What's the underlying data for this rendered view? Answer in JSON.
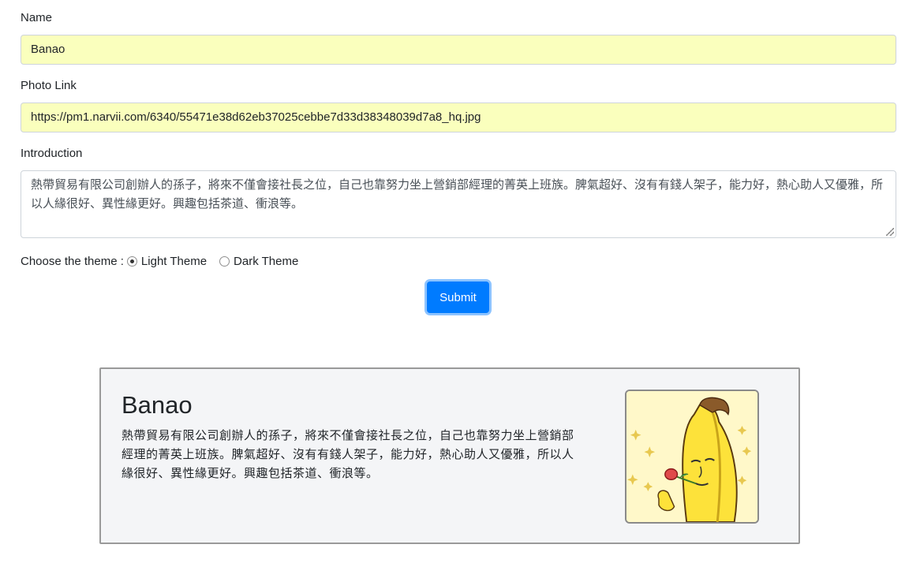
{
  "form": {
    "name_label": "Name",
    "name_value": "Banao",
    "photo_label": "Photo Link",
    "photo_value": "https://pm1.narvii.com/6340/55471e38d62eb37025cebbe7d33d38348039d7a8_hq.jpg",
    "intro_label": "Introduction",
    "intro_value": "熱帶貿易有限公司創辦人的孫子，將來不僅會接社長之位，自己也靠努力坐上營銷部經理的菁英上班族。脾氣超好、沒有有錢人架子，能力好，熱心助人又優雅，所以人緣很好、異性緣更好。興趣包括茶道、衝浪等。",
    "theme_label": "Choose the theme :",
    "theme_options": [
      {
        "label": "Light Theme",
        "checked": true
      },
      {
        "label": "Dark Theme",
        "checked": false
      }
    ],
    "submit_label": "Submit"
  },
  "card": {
    "name": "Banao",
    "intro": "熱帶貿易有限公司創辦人的孫子，將來不僅會接社長之位，自己也靠努力坐上營銷部經理的菁英上班族。脾氣超好、沒有有錢人架子，能力好，熱心助人又優雅，所以人緣很好、異性緣更好。興趣包括茶道、衝浪等。",
    "photo_icon": "banana-character-illustration"
  },
  "colors": {
    "input_autofill_bg": "#faffbd",
    "primary": "#007bff",
    "card_bg": "#f4f5f7",
    "banana_yellow": "#fde23a"
  }
}
